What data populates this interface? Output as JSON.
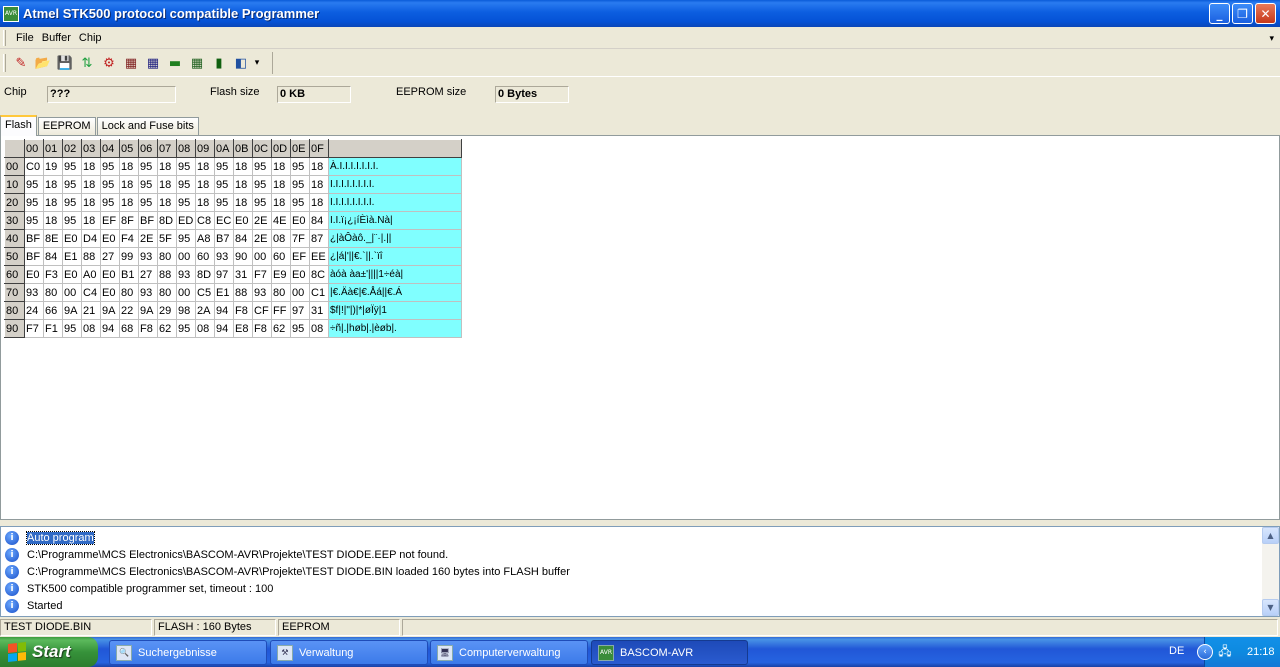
{
  "window": {
    "title": "Atmel STK500 protocol compatible Programmer",
    "minimize": "_",
    "restore": "❐",
    "close": "✕"
  },
  "menu": {
    "items": [
      "File",
      "Buffer",
      "Chip"
    ],
    "overflow": "▾"
  },
  "toolbar": {
    "icons": [
      "erase-icon",
      "open-icon",
      "save-icon",
      "verify-icon",
      "program-icon",
      "read-icon",
      "write-icon",
      "chip-icon",
      "fuse-icon",
      "lock-icon",
      "auto-program-icon"
    ],
    "glyphs": [
      "✎",
      "📂",
      "💾",
      "⇅",
      "⚙",
      "▦",
      "▦",
      "▬",
      "▦",
      "▮",
      "◧"
    ],
    "dropdown": "▾"
  },
  "info": {
    "chip_label": "Chip",
    "chip_value": "???",
    "flash_label": "Flash size",
    "flash_value": "0 KB",
    "eeprom_label": "EEPROM size",
    "eeprom_value": "0 Bytes"
  },
  "tabs": [
    "Flash",
    "EEPROM",
    "Lock and Fuse bits"
  ],
  "hex": {
    "columns": [
      "00",
      "01",
      "02",
      "03",
      "04",
      "05",
      "06",
      "07",
      "08",
      "09",
      "0A",
      "0B",
      "0C",
      "0D",
      "0E",
      "0F"
    ],
    "rows": [
      {
        "addr": "00",
        "bytes": [
          "C0",
          "19",
          "95",
          "18",
          "95",
          "18",
          "95",
          "18",
          "95",
          "18",
          "95",
          "18",
          "95",
          "18",
          "95",
          "18"
        ],
        "ascii": "À.I.I.I.I.I.I.I."
      },
      {
        "addr": "10",
        "bytes": [
          "95",
          "18",
          "95",
          "18",
          "95",
          "18",
          "95",
          "18",
          "95",
          "18",
          "95",
          "18",
          "95",
          "18",
          "95",
          "18"
        ],
        "ascii": "I.I.I.I.I.I.I.I."
      },
      {
        "addr": "20",
        "bytes": [
          "95",
          "18",
          "95",
          "18",
          "95",
          "18",
          "95",
          "18",
          "95",
          "18",
          "95",
          "18",
          "95",
          "18",
          "95",
          "18"
        ],
        "ascii": "I.I.I.I.I.I.I.I."
      },
      {
        "addr": "30",
        "bytes": [
          "95",
          "18",
          "95",
          "18",
          "EF",
          "8F",
          "BF",
          "8D",
          "ED",
          "C8",
          "EC",
          "E0",
          "2E",
          "4E",
          "E0",
          "84"
        ],
        "ascii": "I.I.ï¡¿¡íÈìà.Nà|"
      },
      {
        "addr": "40",
        "bytes": [
          "BF",
          "8E",
          "E0",
          "D4",
          "E0",
          "F4",
          "2E",
          "5F",
          "95",
          "A8",
          "B7",
          "84",
          "2E",
          "08",
          "7F",
          "87"
        ],
        "ascii": "¿|àÔàô._|¨·|.||"
      },
      {
        "addr": "50",
        "bytes": [
          "BF",
          "84",
          "E1",
          "88",
          "27",
          "99",
          "93",
          "80",
          "00",
          "60",
          "93",
          "90",
          "00",
          "60",
          "EF",
          "EE"
        ],
        "ascii": "¿|á|'||€.`||.`ïî"
      },
      {
        "addr": "60",
        "bytes": [
          "E0",
          "F3",
          "E0",
          "A0",
          "E0",
          "B1",
          "27",
          "88",
          "93",
          "8D",
          "97",
          "31",
          "F7",
          "E9",
          "E0",
          "8C"
        ],
        "ascii": "àóà àa±'||||1÷éà|"
      },
      {
        "addr": "70",
        "bytes": [
          "93",
          "80",
          "00",
          "C4",
          "E0",
          "80",
          "93",
          "80",
          "00",
          "C5",
          "E1",
          "88",
          "93",
          "80",
          "00",
          "C1"
        ],
        "ascii": "|€.Äà€|€.Åá||€.Á"
      },
      {
        "addr": "80",
        "bytes": [
          "24",
          "66",
          "9A",
          "21",
          "9A",
          "22",
          "9A",
          "29",
          "98",
          "2A",
          "94",
          "F8",
          "CF",
          "FF",
          "97",
          "31"
        ],
        "ascii": "$f|!|\"|)|*|øÏÿ|1"
      },
      {
        "addr": "90",
        "bytes": [
          "F7",
          "F1",
          "95",
          "08",
          "94",
          "68",
          "F8",
          "62",
          "95",
          "08",
          "94",
          "E8",
          "F8",
          "62",
          "95",
          "08"
        ],
        "ascii": "÷ñ|.|høb|.|èøb|."
      }
    ]
  },
  "log": [
    {
      "text": "Auto program",
      "selected": true
    },
    {
      "text": "C:\\Programme\\MCS Electronics\\BASCOM-AVR\\Projekte\\TEST DIODE.EEP not found.",
      "selected": false
    },
    {
      "text": "C:\\Programme\\MCS Electronics\\BASCOM-AVR\\Projekte\\TEST DIODE.BIN loaded 160 bytes into FLASH buffer",
      "selected": false
    },
    {
      "text": "STK500 compatible programmer set, timeout : 100",
      "selected": false
    },
    {
      "text": "Started",
      "selected": false
    }
  ],
  "status": [
    "TEST DIODE.BIN",
    "FLASH : 160 Bytes",
    "EEPROM",
    ""
  ],
  "taskbar": {
    "start": "Start",
    "buttons": [
      {
        "label": "Suchergebnisse",
        "icon": "search-results-icon",
        "glyph": "🔍",
        "active": false
      },
      {
        "label": "Verwaltung",
        "icon": "admin-tools-icon",
        "glyph": "⚒",
        "active": false
      },
      {
        "label": "Computerverwaltung",
        "icon": "computer-management-icon",
        "glyph": "🖥",
        "active": false
      },
      {
        "label": "BASCOM-AVR",
        "icon": "bascom-icon",
        "glyph": "AVR",
        "active": true
      }
    ],
    "language": "DE",
    "clock": "21:18"
  }
}
